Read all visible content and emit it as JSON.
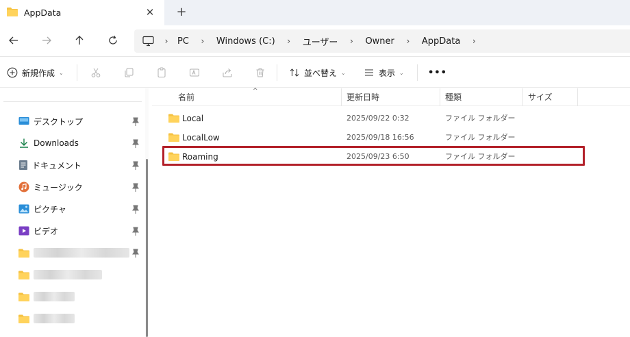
{
  "window": {
    "tab_title": "AppData",
    "close_symbol": "✕",
    "new_tab_symbol": "+"
  },
  "navigation": {
    "back_icon": "arrow-left-icon",
    "forward_icon": "arrow-right-icon",
    "up_icon": "arrow-up-icon",
    "refresh_icon": "refresh-icon",
    "breadcrumbs": [
      "PC",
      "Windows (C:)",
      "ユーザー",
      "Owner",
      "AppData"
    ],
    "chevron": "›"
  },
  "commandbar": {
    "new_label": "新規作成",
    "sort_label": "並べ替え",
    "view_label": "表示",
    "more_label": "•••",
    "dropdown_glyph": "⌄"
  },
  "sidebar": {
    "items": [
      {
        "label": "デスクトップ",
        "icon": "desktop-icon"
      },
      {
        "label": "Downloads",
        "icon": "download-icon"
      },
      {
        "label": "ドキュメント",
        "icon": "document-icon"
      },
      {
        "label": "ミュージック",
        "icon": "music-icon"
      },
      {
        "label": "ピクチャ",
        "icon": "pictures-icon"
      },
      {
        "label": "ビデオ",
        "icon": "video-icon"
      }
    ]
  },
  "filelist": {
    "columns": {
      "name": "名前",
      "date": "更新日時",
      "type": "種類",
      "size": "サイズ"
    },
    "sort_indicator": "^",
    "rows": [
      {
        "name": "Local",
        "date": "2025/09/22 0:32",
        "type": "ファイル フォルダー"
      },
      {
        "name": "LocalLow",
        "date": "2025/09/18 16:56",
        "type": "ファイル フォルダー"
      },
      {
        "name": "Roaming",
        "date": "2025/09/23 6:50",
        "type": "ファイル フォルダー"
      }
    ],
    "highlighted_row": "Roaming"
  },
  "colors": {
    "folder_yellow": "#f5c242",
    "highlight_border": "#b3212a",
    "tabbar_bg": "#eef1f6"
  }
}
